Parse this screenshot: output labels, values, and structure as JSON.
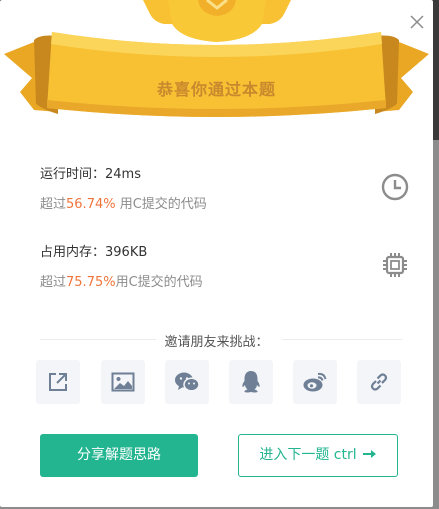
{
  "banner": {
    "title": "恭喜你通过本题"
  },
  "runtime": {
    "label": "运行时间：",
    "value": "24ms",
    "prefix": "超过",
    "percent": "56.74%",
    "suffix": " 用C提交的代码",
    "icon": "clock-icon"
  },
  "memory": {
    "label": "占用内存：",
    "value": "396KB",
    "prefix": "超过",
    "percent": "75.75%",
    "suffix": "用C提交的代码",
    "icon": "chip-icon"
  },
  "invite": {
    "label": "邀请朋友来挑战：",
    "buttons": [
      "share-icon",
      "image-icon",
      "wechat-icon",
      "qq-icon",
      "weibo-icon",
      "link-icon"
    ]
  },
  "actions": {
    "share_solution": "分享解题思路",
    "next_problem": "进入下一题 ctrl"
  },
  "colors": {
    "accent": "#22b58f",
    "highlight": "#f0753b",
    "banner_gold": "#f7c133"
  }
}
